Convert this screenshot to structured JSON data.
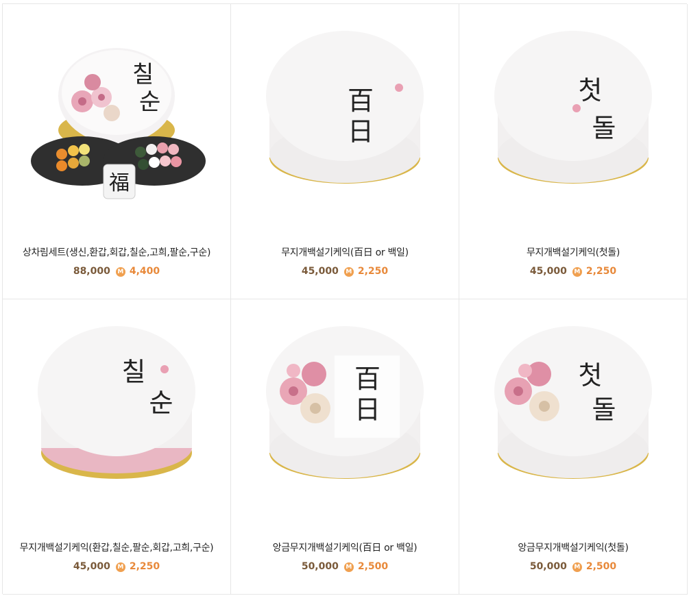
{
  "currency_icon": "mileage-coin-icon",
  "colors": {
    "price": "#7a5a3a",
    "mileage": "#e8893a",
    "coin": "#f0a050",
    "border": "#e6e6e6"
  },
  "products": [
    {
      "name": "상차림세트(생신,환갑,회갑,칠순,고희,팔순,구순)",
      "price": "88,000",
      "mileage": "4,400",
      "cake_text": [
        "칠",
        "순"
      ],
      "style": "set"
    },
    {
      "name": "무지개백설기케익(百日 or 백일)",
      "price": "45,000",
      "mileage": "2,250",
      "cake_text": [
        "百",
        "日"
      ],
      "style": "plain"
    },
    {
      "name": "무지개백설기케익(첫돌)",
      "price": "45,000",
      "mileage": "2,250",
      "cake_text": [
        "첫",
        "돌"
      ],
      "style": "plain"
    },
    {
      "name": "무지개백설기케익(환갑,칠순,팔순,회갑,고희,구순)",
      "price": "45,000",
      "mileage": "2,250",
      "cake_text": [
        "칠",
        "순"
      ],
      "style": "plain"
    },
    {
      "name": "앙금무지개백설기케익(百日 or 백일)",
      "price": "50,000",
      "mileage": "2,500",
      "cake_text": [
        "百",
        "日"
      ],
      "style": "flower"
    },
    {
      "name": "앙금무지개백설기케익(첫돌)",
      "price": "50,000",
      "mileage": "2,500",
      "cake_text": [
        "첫",
        "돌"
      ],
      "style": "flower"
    }
  ],
  "coin_letter": "M",
  "set_seal_text": "福"
}
